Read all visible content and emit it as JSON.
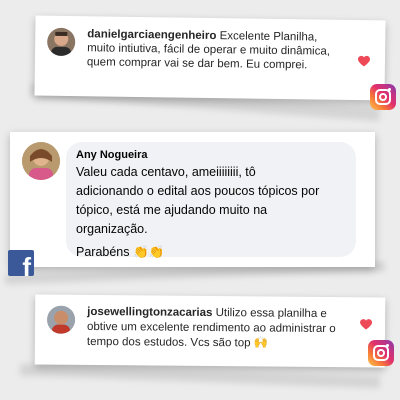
{
  "comments": [
    {
      "platform": "instagram",
      "username": "danielgarciaengenheiro",
      "text": " Excelente Planilha, muito intiutiva, fácil de operar e muito dinâmica, quem comprar vai se dar bem. Eu comprei.",
      "liked": true,
      "icon": "instagram-icon"
    },
    {
      "platform": "facebook",
      "username": "Any Nogueira",
      "text_lines": [
        "Valeu cada centavo, ameiiiiiiii, tô",
        "adicionando o edital aos poucos tópicos por",
        "tópico, está me ajudando muito na",
        "organização."
      ],
      "sign_off": "Parabéns 👏👏",
      "icon": "facebook-icon"
    },
    {
      "platform": "instagram",
      "username": "josewellingtonzacarias",
      "text": " Utilizo essa planilha e obtive um excelente rendimento ao administrar o tempo dos estudos. Vcs são top 🙌",
      "liked": true,
      "icon": "instagram-icon"
    }
  ],
  "colors": {
    "heart": "#ed4956",
    "facebook": "#3b5998",
    "bubble": "#f0f2f5"
  }
}
